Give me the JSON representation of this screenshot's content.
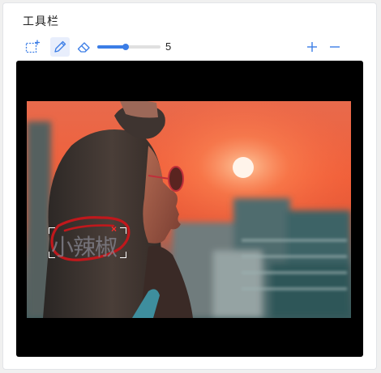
{
  "panel": {
    "title": "工具栏"
  },
  "toolbar": {
    "tools": [
      {
        "name": "crop-select-icon",
        "active": false
      },
      {
        "name": "pencil-icon",
        "active": true
      },
      {
        "name": "eraser-icon",
        "active": false
      }
    ],
    "brush_size": {
      "value": "5",
      "fraction": 0.45
    },
    "zoom_in_label": "+",
    "zoom_out_label": "−"
  },
  "canvas": {
    "selection": {
      "text": "小辣椒",
      "delete_label": "×"
    }
  },
  "colors": {
    "accent": "#3b7de6",
    "annotation_red": "#c0181c",
    "delete_red": "#ff2a2a"
  }
}
